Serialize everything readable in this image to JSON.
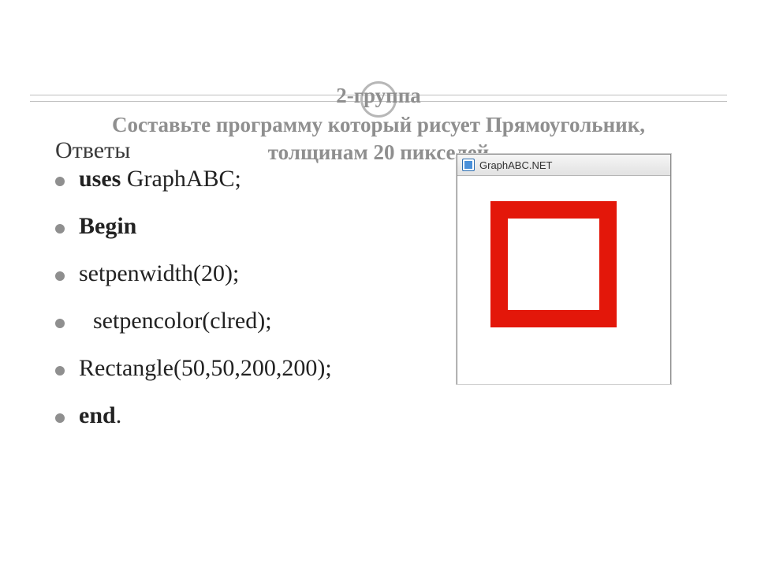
{
  "heading": {
    "line1": "2-группа",
    "line2": "Составьте программу который рисует Прямоугольник,",
    "line3": "толщинам  20 пикселей"
  },
  "answers_label": "Ответы",
  "code": {
    "l1_uses_kw": "uses",
    "l1_uses_rest": " GraphABC;",
    "l2_begin": "Begin",
    "l3": "setpenwidth(20);",
    "l4": "setpencolor(clred);",
    "l5": "Rectangle(50,50,200,200);",
    "l6_kw": "end",
    "l6_dot": "."
  },
  "window": {
    "title": "GraphABC.NET",
    "icon_name": "app-icon"
  },
  "colors": {
    "rect_stroke": "#e3170a",
    "heading_text": "#8f8f8f"
  }
}
